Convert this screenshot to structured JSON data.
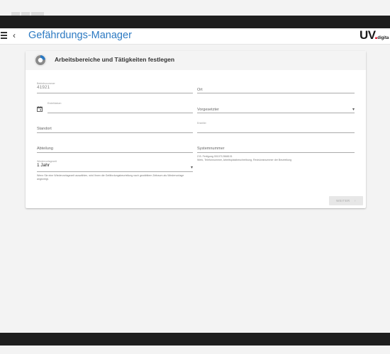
{
  "app": {
    "title": "Gefährdungs-Manager",
    "logo_main": "UV",
    "logo_sub": "digita"
  },
  "card": {
    "title": "Arbeitsbereiche und Tätigkeiten festlegen"
  },
  "form": {
    "betriebsnummer": {
      "label": "Betriebsnummer",
      "value": "41921"
    },
    "ort": {
      "placeholder": "Ort"
    },
    "erstelldatum": {
      "label": "Erstelldatum",
      "value": ""
    },
    "vorgesetzter": {
      "placeholder": "Vorgesetzter"
    },
    "standort": {
      "placeholder": "Standort"
    },
    "ersteller": {
      "label": "Ersteller",
      "value": ""
    },
    "abteilung": {
      "placeholder": "Abteilung"
    },
    "systemnummer": {
      "placeholder": "Systemnummer",
      "hint": "Z.B. Fertigung 0010712668101<br>Werk, Telefonnummer, Arbeitsplatzbeschreibung, Revisionsnummer der Beurteilung"
    },
    "wiedervorlagezeit": {
      "label": "Wiedervorlagezeit",
      "value": "1 Jahr",
      "hint": "Wenn Sie eine Wiedervorlagezeit auswählen, wird Ihnen die Gefährdungsbeurteilung nach gewähltem Zeitraum als Wiedervorlage angezeigt."
    }
  },
  "buttons": {
    "weiter": "WEITER"
  },
  "colors": {
    "accent": "#2b79c2",
    "logo_dot": "#e2001a"
  },
  "icons": {
    "menu": "menu-icon",
    "back": "back-icon",
    "card": "pie-chart-icon",
    "calendar": "calendar-icon",
    "dropdown": "dropdown-caret-icon",
    "next": "chevron-right-icon"
  }
}
